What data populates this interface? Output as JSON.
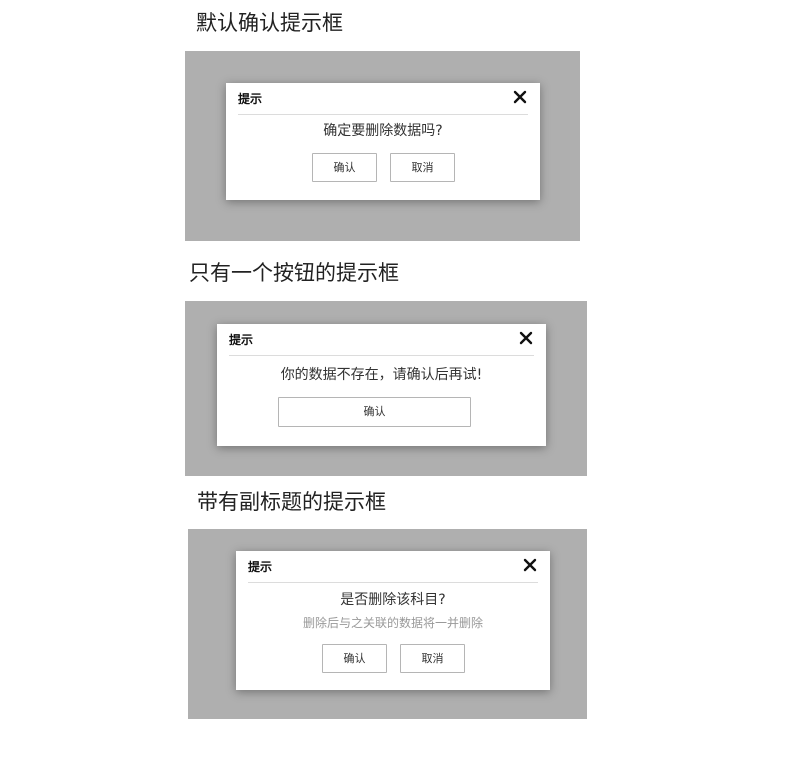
{
  "sections": [
    {
      "heading": "默认确认提示框",
      "dialog": {
        "title": "提示",
        "message": "确定要删除数据吗?",
        "confirm_label": "确认",
        "cancel_label": "取消",
        "close_icon": "close-icon"
      }
    },
    {
      "heading": "只有一个按钮的提示框",
      "dialog": {
        "title": "提示",
        "message": "你的数据不存在，请确认后再试!",
        "confirm_label": "确认",
        "close_icon": "close-icon"
      }
    },
    {
      "heading": "带有副标题的提示框",
      "dialog": {
        "title": "提示",
        "message": "是否删除该科目?",
        "subtitle": "删除后与之关联的数据将一并删除",
        "confirm_label": "确认",
        "cancel_label": "取消",
        "close_icon": "close-icon"
      }
    }
  ],
  "colors": {
    "overlay": "#afafaf",
    "dialog_background": "#ffffff",
    "button_border": "#b5b5b5",
    "subtitle_text": "#999999"
  }
}
